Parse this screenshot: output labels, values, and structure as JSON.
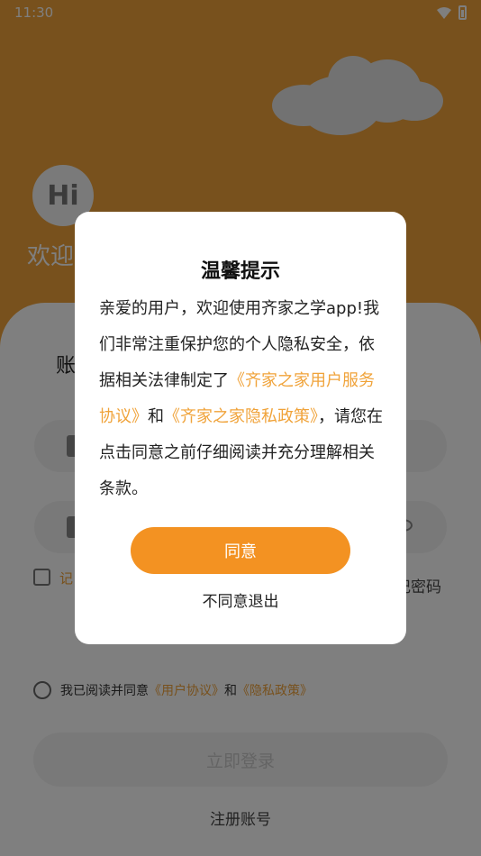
{
  "status_bar": {
    "time": "11:30"
  },
  "hero": {
    "avatar_text": "Hi",
    "welcome": "欢迎"
  },
  "login": {
    "title": "账",
    "remember": "记",
    "forgot": "忘记密码",
    "agree_prefix": "我已阅读并同意",
    "user_agreement_link": "《用户协议》",
    "and": "和",
    "privacy_policy_link": "《隐私政策》",
    "login_button": "立即登录",
    "register_link": "注册账号"
  },
  "dialog": {
    "title": "温馨提示",
    "body_part1": "亲爱的用户，欢迎使用齐家之学app!我们非常注重保护您的个人隐私安全，依据相关法律制定了",
    "link_service": "《齐家之家用户服务协议》",
    "body_and": "和",
    "link_privacy": "《齐家之家隐私政策》",
    "body_part2": "，请您在点击同意之前仔细阅读并充分理解相关条款。",
    "agree_button": "同意",
    "decline_button": "不同意退出"
  },
  "colors": {
    "accent": "#f0a33a",
    "button": "#f39222"
  },
  "icons": [
    "wifi-icon",
    "battery-icon",
    "cloud-icon",
    "lock-icon",
    "eye-icon",
    "user-icon"
  ]
}
